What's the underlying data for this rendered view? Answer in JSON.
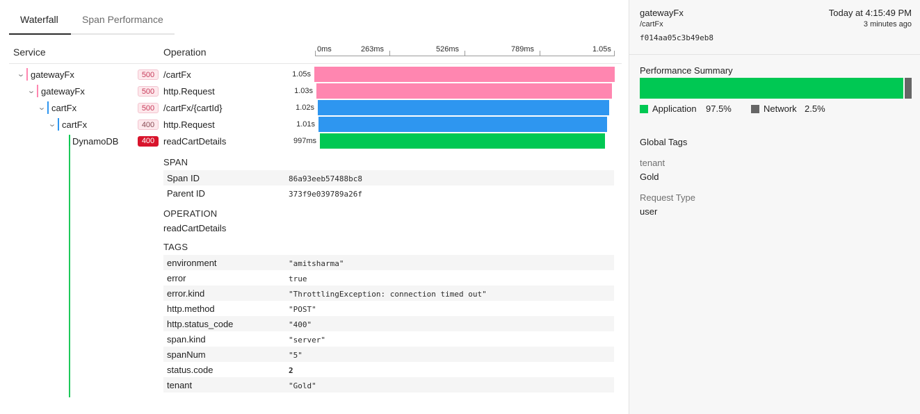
{
  "tabs": [
    {
      "label": "Waterfall",
      "active": true
    },
    {
      "label": "Span Performance",
      "active": false
    }
  ],
  "columns": {
    "service": "Service",
    "operation": "Operation"
  },
  "ruler": {
    "ticks": [
      "0ms",
      "263ms",
      "526ms",
      "789ms",
      "1.05s"
    ]
  },
  "colors": {
    "gatewayFx": "#ff86b0",
    "cartFx": "#2e96f0",
    "DynamoDB": "#00c853",
    "network": "#666666"
  },
  "spans": [
    {
      "service": "gatewayFx",
      "status": "500",
      "operation": "/cartFx",
      "duration": "1.05s"
    },
    {
      "service": "gatewayFx",
      "status": "500",
      "operation": "http.Request",
      "duration": "1.03s"
    },
    {
      "service": "cartFx",
      "status": "500",
      "operation": "/cartFx/{cartId}",
      "duration": "1.02s"
    },
    {
      "service": "cartFx",
      "status": "400",
      "operation": "http.Request",
      "duration": "1.01s"
    },
    {
      "service": "DynamoDB",
      "status": "400",
      "operation": "readCartDetails",
      "duration": "997ms",
      "selected": true
    }
  ],
  "detail": {
    "span_title": "SPAN",
    "span_fields": [
      {
        "key": "Span ID",
        "value": "86a93eeb57488bc8"
      },
      {
        "key": "Parent ID",
        "value": "373f9e039789a26f"
      }
    ],
    "operation_title": "OPERATION",
    "operation_value": "readCartDetails",
    "tags_title": "TAGS",
    "tags": [
      {
        "key": "environment",
        "value": "\"amitsharma\""
      },
      {
        "key": "error",
        "value": "true"
      },
      {
        "key": "error.kind",
        "value": "\"ThrottlingException: connection timed out\""
      },
      {
        "key": "http.method",
        "value": "\"POST\""
      },
      {
        "key": "http.status_code",
        "value": "\"400\""
      },
      {
        "key": "span.kind",
        "value": "\"server\""
      },
      {
        "key": "spanNum",
        "value": "\"5\""
      },
      {
        "key": "status.code",
        "value": "2"
      },
      {
        "key": "tenant",
        "value": "\"Gold\""
      }
    ]
  },
  "panel": {
    "service": "gatewayFx",
    "operation": "/cartFx",
    "trace_id": "f014aa05c3b49eb8",
    "time": "Today at 4:15:49 PM",
    "ago": "3 minutes ago",
    "perf_title": "Performance Summary",
    "application_label": "Application",
    "application_pct": "97.5%",
    "application_value": 97.5,
    "network_label": "Network",
    "network_pct": "2.5%",
    "network_value": 2.5,
    "global_tags_title": "Global Tags",
    "global_tags": [
      {
        "key": "tenant",
        "value": "Gold"
      },
      {
        "key": "Request Type",
        "value": "user"
      }
    ]
  }
}
